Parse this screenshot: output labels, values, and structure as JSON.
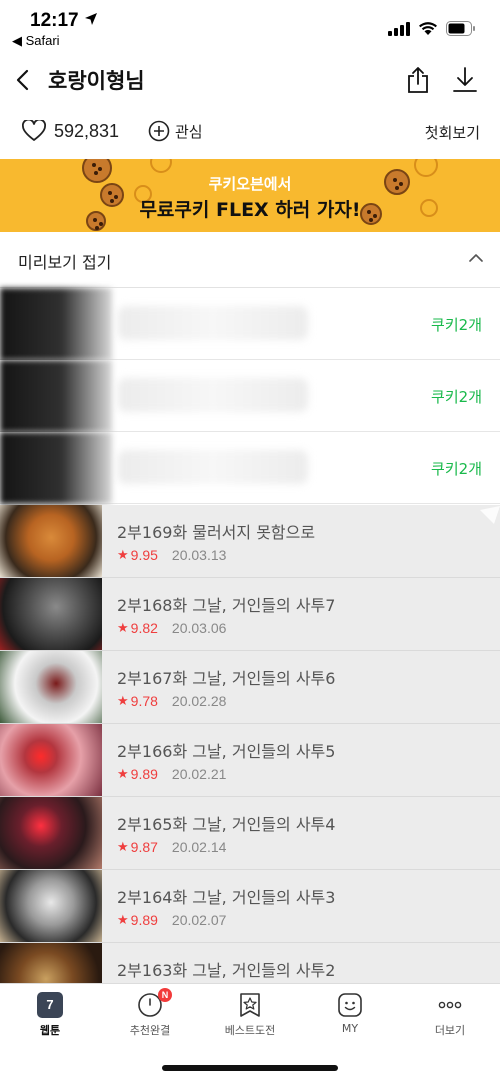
{
  "status_bar": {
    "time": "12:17",
    "back_app": "◀ Safari"
  },
  "header": {
    "title": "호랑이형님"
  },
  "actions": {
    "likes": "592,831",
    "favorite_label": "관심",
    "first_episode_label": "첫회보기"
  },
  "banner": {
    "line1": "쿠키오븐에서",
    "line2": "무료쿠키 FLEX 하러 가자!"
  },
  "preview": {
    "label": "미리보기 접기"
  },
  "locked_episodes": [
    {
      "price": "쿠키2개"
    },
    {
      "price": "쿠키2개"
    },
    {
      "price": "쿠키2개"
    }
  ],
  "episodes": [
    {
      "title": "2부169화 물러서지 못함으로",
      "rating": "9.95",
      "date": "20.03.13"
    },
    {
      "title": "2부168화 그날, 거인들의 사투7",
      "rating": "9.82",
      "date": "20.03.06"
    },
    {
      "title": "2부167화 그날, 거인들의 사투6",
      "rating": "9.78",
      "date": "20.02.28"
    },
    {
      "title": "2부166화 그날, 거인들의 사투5",
      "rating": "9.89",
      "date": "20.02.21"
    },
    {
      "title": "2부165화 그날, 거인들의 사투4",
      "rating": "9.87",
      "date": "20.02.14"
    },
    {
      "title": "2부164화 그날, 거인들의 사투3",
      "rating": "9.89",
      "date": "20.02.07"
    },
    {
      "title": "2부163화 그날, 거인들의 사투2",
      "rating": "",
      "date": ""
    }
  ],
  "tabbar": {
    "tabs": [
      {
        "label": "웹툰",
        "icon": "webtoon-icon",
        "badge": "7"
      },
      {
        "label": "추천완결",
        "icon": "clock-icon",
        "badge": "N"
      },
      {
        "label": "베스트도전",
        "icon": "star-book-icon"
      },
      {
        "label": "MY",
        "icon": "smile-icon"
      },
      {
        "label": "더보기",
        "icon": "more-icon"
      }
    ]
  },
  "colors": {
    "accent_green": "#19b94b",
    "rating_red": "#ef3e3e",
    "banner_yellow": "#f8b92f"
  }
}
